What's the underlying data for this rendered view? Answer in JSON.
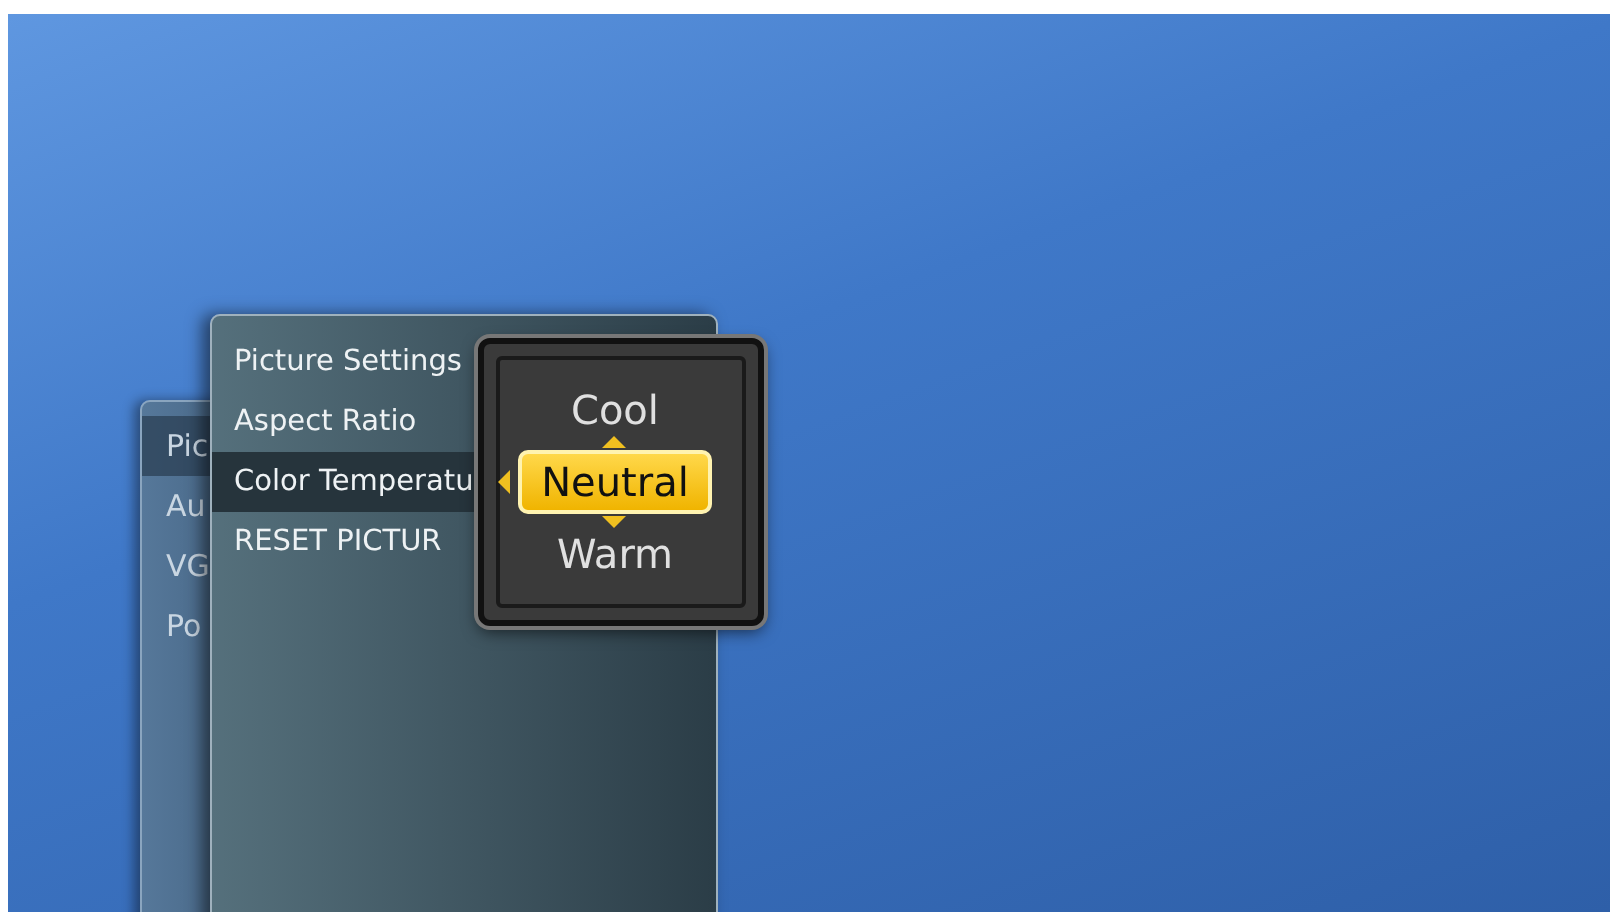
{
  "back_menu": {
    "items": [
      {
        "label": "Pic",
        "selected": true
      },
      {
        "label": "Au",
        "selected": false
      },
      {
        "label": "VG",
        "selected": false
      },
      {
        "label": "Po",
        "selected": false
      }
    ]
  },
  "picture_menu": {
    "items": [
      {
        "label": "Picture Settings",
        "selected": false
      },
      {
        "label": "Aspect Ratio",
        "selected": false
      },
      {
        "label": "Color Temperatu",
        "selected": true
      },
      {
        "label": "RESET PICTUR",
        "selected": false
      }
    ]
  },
  "color_temperature_popup": {
    "options": [
      {
        "label": "Cool",
        "selected": false
      },
      {
        "label": "Neutral",
        "selected": true
      },
      {
        "label": "Warm",
        "selected": false
      }
    ]
  }
}
